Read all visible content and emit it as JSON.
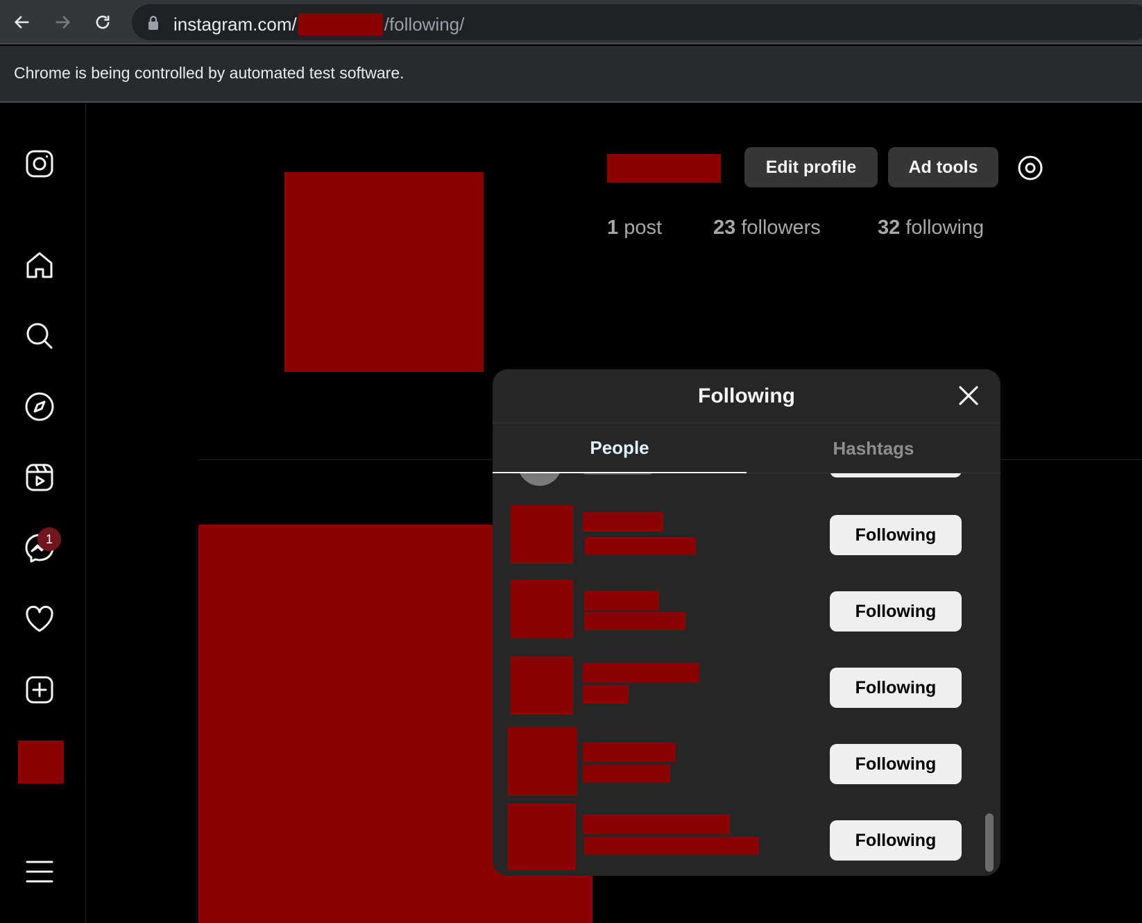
{
  "browser": {
    "url_prefix": "instagram.com/",
    "url_suffix": "/following/",
    "infobar_text": "Chrome is being controlled by automated test software."
  },
  "sidebar": {
    "icons": [
      "instagram-logo-icon",
      "home-icon",
      "search-icon",
      "explore-icon",
      "reels-icon",
      "messenger-icon",
      "heart-icon",
      "create-icon",
      "menu-icon"
    ],
    "messages_badge": "1"
  },
  "profile": {
    "edit_profile_label": "Edit profile",
    "ad_tools_label": "Ad tools",
    "posts_count": "1",
    "posts_label": "post",
    "followers_count": "23",
    "followers_label": "followers",
    "following_count": "32",
    "following_label": "following"
  },
  "modal": {
    "title": "Following",
    "tabs": [
      {
        "label": "People",
        "active": true
      },
      {
        "label": "Hashtags",
        "active": false
      }
    ],
    "rows": [
      {
        "button_label": "Following"
      },
      {
        "button_label": "Following"
      },
      {
        "button_label": "Following"
      },
      {
        "button_label": "Following"
      },
      {
        "button_label": "Following"
      }
    ]
  },
  "colors": {
    "redaction": "#8b0000",
    "button_dark": "#363636",
    "button_light": "#efefef",
    "modal_bg": "#262626"
  }
}
